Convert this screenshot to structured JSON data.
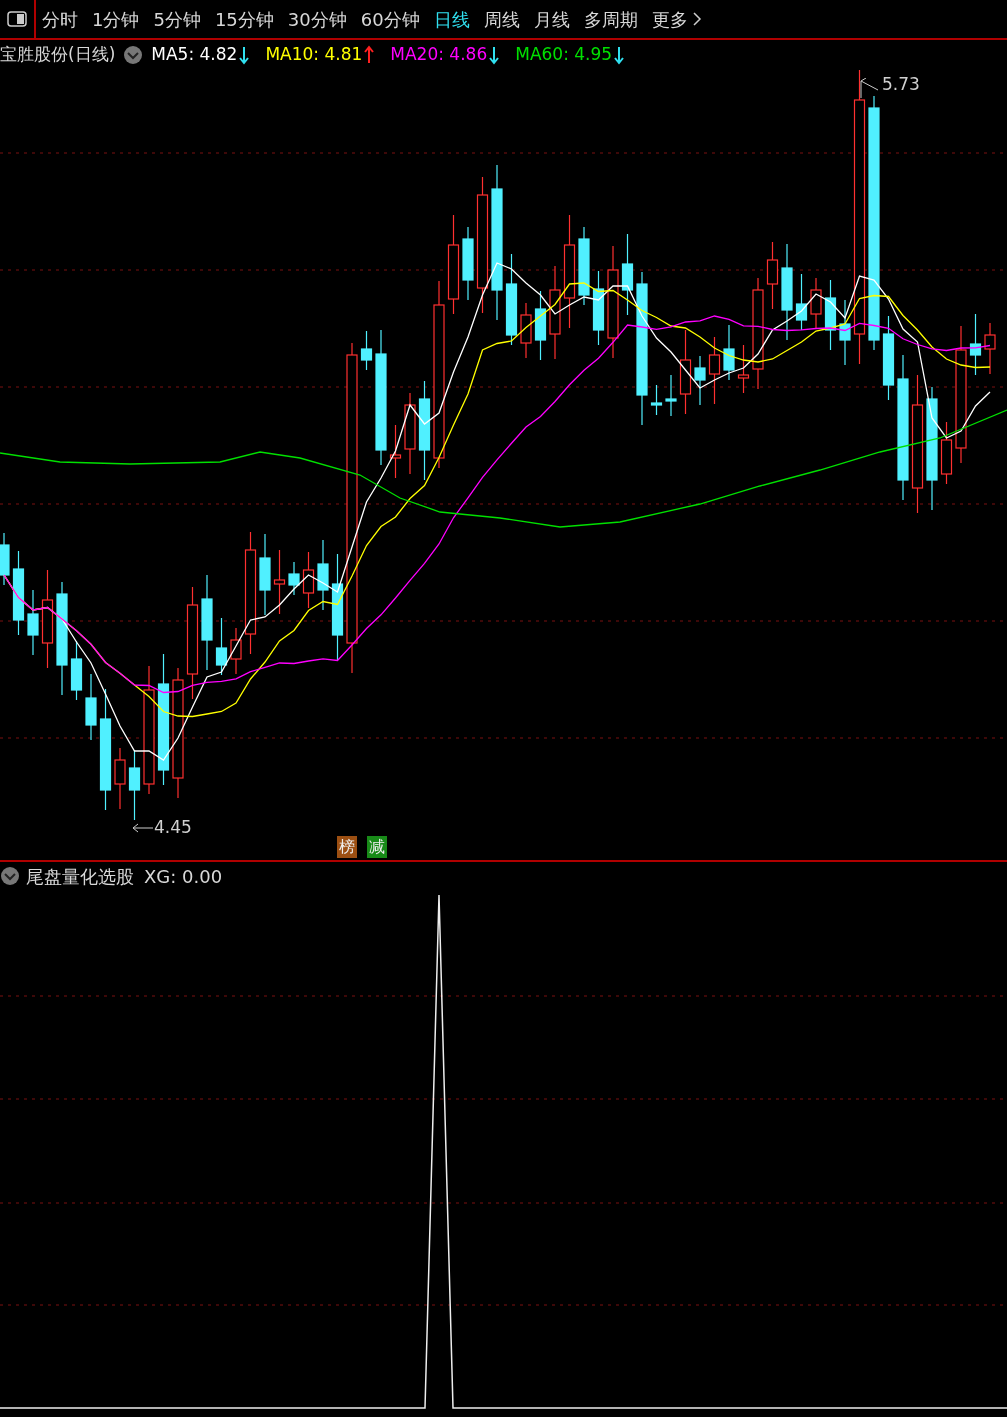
{
  "toolbar": {
    "periods": [
      {
        "label": "分时",
        "selected": false
      },
      {
        "label": "1分钟",
        "selected": false
      },
      {
        "label": "5分钟",
        "selected": false
      },
      {
        "label": "15分钟",
        "selected": false
      },
      {
        "label": "30分钟",
        "selected": false
      },
      {
        "label": "60分钟",
        "selected": false
      },
      {
        "label": "日线",
        "selected": true
      },
      {
        "label": "周线",
        "selected": false
      },
      {
        "label": "月线",
        "selected": false
      },
      {
        "label": "多周期",
        "selected": false
      },
      {
        "label": "更多",
        "selected": false
      }
    ]
  },
  "chart": {
    "title": "宝胜股份(日线)",
    "ma": [
      {
        "label": "MA5: 4.82",
        "color": "#ffffff",
        "rising": false
      },
      {
        "label": "MA10: 4.81",
        "color": "#ffff00",
        "rising": true
      },
      {
        "label": "MA20: 4.86",
        "color": "#ff00ff",
        "rising": false
      },
      {
        "label": "MA60: 4.95",
        "color": "#00e000",
        "rising": false
      }
    ],
    "high_marker": "5.73",
    "low_marker": "4.45",
    "badges": [
      {
        "label": "榜",
        "color": "#9c4f12"
      },
      {
        "label": "减",
        "color": "#188a18"
      }
    ]
  },
  "indicator": {
    "title": "尾盘量化选股",
    "value": "XG: 0.00"
  }
}
